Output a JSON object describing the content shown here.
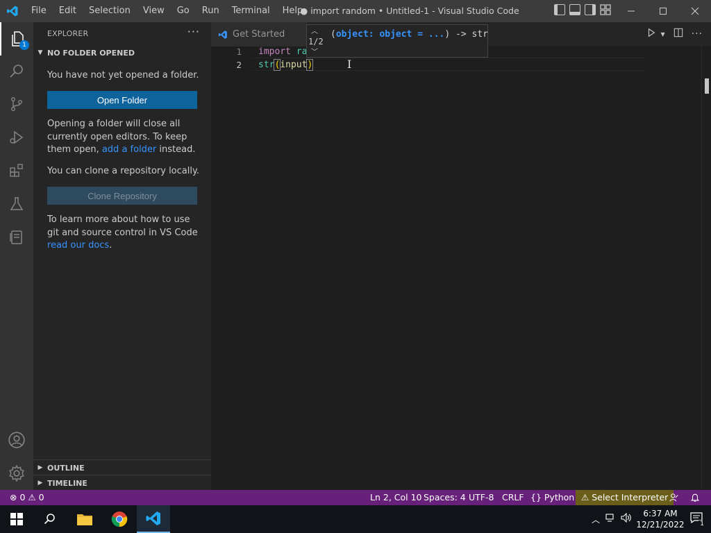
{
  "titlebar": {
    "menu": [
      "File",
      "Edit",
      "Selection",
      "View",
      "Go",
      "Run",
      "Terminal",
      "Help"
    ],
    "window_title": "● import random • Untitled-1 - Visual Studio Code"
  },
  "activitybar": {
    "explorer_badge": "1"
  },
  "sidebar": {
    "title": "EXPLORER",
    "more": "···",
    "section_title": "NO FOLDER OPENED",
    "no_folder_text": "You have not yet opened a folder.",
    "open_folder_label": "Open Folder",
    "close_warning_pre": "Opening a folder will close all currently open editors. To keep them open, ",
    "add_folder_link": "add a folder",
    "close_warning_post": " instead.",
    "clone_text": "You can clone a repository locally.",
    "clone_button_label": "Clone Repository",
    "learn_more_pre": "To learn more about how to use git and source control in VS Code ",
    "docs_link": "read our docs",
    "learn_more_post": ".",
    "outline_label": "OUTLINE",
    "timeline_label": "TIMELINE"
  },
  "editor": {
    "tab_label": "Get Started",
    "line_numbers": [
      "1",
      "2"
    ],
    "line1_kw": "import",
    "line1_rest": " ra",
    "line2_fn": "str",
    "line2_open": "(",
    "line2_arg": "input",
    "line2_close": ")",
    "signature": {
      "counter": "1/2",
      "open": "(",
      "param": "object: object = ...",
      "close": ") -> str"
    }
  },
  "statusbar": {
    "problems": "0",
    "warnings": "0",
    "position": "Ln 2, Col 10",
    "spaces": "Spaces: 4",
    "encoding": "UTF-8",
    "eol": "CRLF",
    "language": "Python",
    "interpreter": "Select Interpreter"
  },
  "taskbar": {
    "time": "6:37 AM",
    "date": "12/21/2022",
    "notification_count": "1"
  },
  "colors": {
    "accent": "#0e639c",
    "statusbar": "#68217a",
    "link": "#3794ff"
  }
}
